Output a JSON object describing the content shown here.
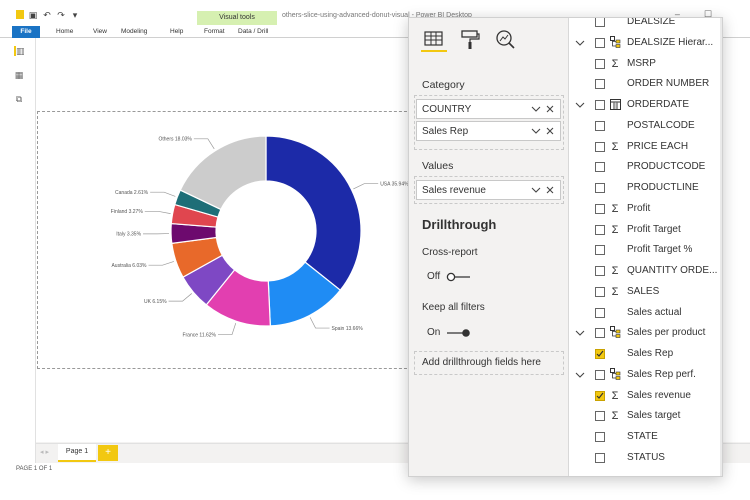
{
  "window": {
    "title": "others-slice-using-advanced-donut-visual - Power BI Desktop",
    "contextual_tab": "Visual tools"
  },
  "ribbon": {
    "tabs": [
      "File",
      "Home",
      "View",
      "Modeling",
      "Help",
      "Format",
      "Data / Drill"
    ]
  },
  "chart_data": {
    "type": "pie",
    "donut": true,
    "categories": [
      "USA",
      "Spain",
      "France",
      "UK",
      "Australia",
      "Italy",
      "Finland",
      "Canada",
      "Others"
    ],
    "values": [
      35.94,
      13.66,
      11.62,
      6.15,
      6.03,
      3.35,
      3.27,
      2.61,
      18.03
    ],
    "labels": [
      "USA 35.94%",
      "Spain 13.66%",
      "France 11.62%",
      "UK 6.15%",
      "Australia 6.03%",
      "Italy 3.35%",
      "Finland 3.27%",
      "Canada 2.61%",
      "Others 18.03%"
    ],
    "colors": [
      "#1c2aa8",
      "#1f8cf4",
      "#e23fb0",
      "#7e48c4",
      "#e8692a",
      "#6d0a6e",
      "#e0464f",
      "#1e6e77",
      "#cccccc"
    ]
  },
  "pages": {
    "tabs": [
      "Page 1"
    ],
    "status": "PAGE 1 OF 1"
  },
  "pane": {
    "icons": [
      "fields-icon",
      "format-roller-icon",
      "analytics-icon"
    ],
    "category_label": "Category",
    "category_fields": [
      "COUNTRY",
      "Sales Rep"
    ],
    "values_label": "Values",
    "values_fields": [
      "Sales revenue"
    ],
    "drillthrough": {
      "header": "Drillthrough",
      "cross_report_label": "Cross-report",
      "cross_report_state": "Off",
      "keep_filters_label": "Keep all filters",
      "keep_filters_state": "On",
      "drop_hint": "Add drillthrough fields here"
    }
  },
  "fields": [
    {
      "name": "DEALSIZE",
      "expand": false,
      "checked": false,
      "icon": "none"
    },
    {
      "name": "DEALSIZE Hierar...",
      "expand": true,
      "checked": false,
      "icon": "hierarchy"
    },
    {
      "name": "MSRP",
      "expand": false,
      "checked": false,
      "icon": "sigma"
    },
    {
      "name": "ORDER NUMBER",
      "expand": false,
      "checked": false,
      "icon": "none"
    },
    {
      "name": "ORDERDATE",
      "expand": true,
      "checked": false,
      "icon": "calendar"
    },
    {
      "name": "POSTALCODE",
      "expand": false,
      "checked": false,
      "icon": "none"
    },
    {
      "name": "PRICE EACH",
      "expand": false,
      "checked": false,
      "icon": "sigma"
    },
    {
      "name": "PRODUCTCODE",
      "expand": false,
      "checked": false,
      "icon": "none"
    },
    {
      "name": "PRODUCTLINE",
      "expand": false,
      "checked": false,
      "icon": "none"
    },
    {
      "name": "Profit",
      "expand": false,
      "checked": false,
      "icon": "sigma"
    },
    {
      "name": "Profit Target",
      "expand": false,
      "checked": false,
      "icon": "sigma"
    },
    {
      "name": "Profit Target %",
      "expand": false,
      "checked": false,
      "icon": "none"
    },
    {
      "name": "QUANTITY ORDE...",
      "expand": false,
      "checked": false,
      "icon": "sigma"
    },
    {
      "name": "SALES",
      "expand": false,
      "checked": false,
      "icon": "sigma"
    },
    {
      "name": "Sales actual",
      "expand": false,
      "checked": false,
      "icon": "none"
    },
    {
      "name": "Sales per product",
      "expand": true,
      "checked": false,
      "icon": "hierarchy"
    },
    {
      "name": "Sales Rep",
      "expand": false,
      "checked": true,
      "icon": "none"
    },
    {
      "name": "Sales Rep perf.",
      "expand": true,
      "checked": false,
      "icon": "hierarchy"
    },
    {
      "name": "Sales revenue",
      "expand": false,
      "checked": true,
      "icon": "sigma"
    },
    {
      "name": "Sales target",
      "expand": false,
      "checked": false,
      "icon": "sigma"
    },
    {
      "name": "STATE",
      "expand": false,
      "checked": false,
      "icon": "none"
    },
    {
      "name": "STATUS",
      "expand": false,
      "checked": false,
      "icon": "none"
    }
  ]
}
